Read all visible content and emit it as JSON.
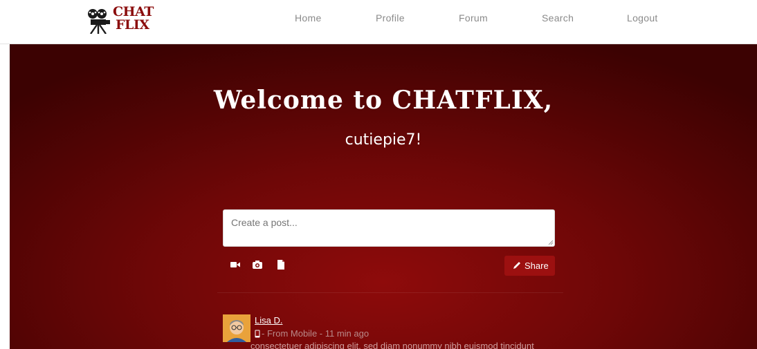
{
  "nav": {
    "logo_line1": "CHAT",
    "logo_line2": "FLIX",
    "links": [
      "Home",
      "Profile",
      "Forum",
      "Search",
      "Logout"
    ]
  },
  "hero": {
    "title": "Welcome to CHATFLIX,",
    "subtitle": "cutiepie7!"
  },
  "composer": {
    "placeholder": "Create a post...",
    "attach_icons": [
      "video-camera-icon",
      "camera-icon",
      "file-icon"
    ],
    "share_label": "Share"
  },
  "feed": {
    "posts": [
      {
        "author": "Lisa D.",
        "meta": "- From Mobile - 11 min ago",
        "body": "consectetuer adipiscing elit, sed diam nonummy nibh euismod tincidunt"
      }
    ]
  },
  "colors": {
    "brand": "#8b0d0d",
    "share_button": "#9c1010",
    "hero_dark": "#3c0202",
    "hero_mid": "#8e0b0b"
  }
}
